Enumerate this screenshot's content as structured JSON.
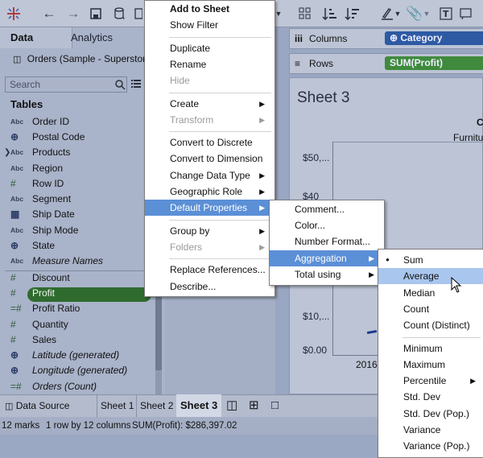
{
  "toolbar": {
    "icons": [
      "tableau-logo-icon",
      "back-icon",
      "forward-icon",
      "save-icon",
      "new-datasource-icon",
      "new-sheet-icon",
      "swap-icon",
      "sort-asc-icon",
      "sort-desc-icon",
      "highlight-icon",
      "pin-icon",
      "text-icon"
    ]
  },
  "left_pane": {
    "tab_data": "Data",
    "tab_analytics": "Analytics",
    "datasource": "Orders (Sample - Superstore)",
    "search_placeholder": "Search",
    "tables_heading": "Tables",
    "fields": [
      {
        "type": "Abc",
        "name": "Order ID"
      },
      {
        "type": "globe",
        "name": "Postal Code"
      },
      {
        "type": "Abc",
        "name": "Products",
        "expandable": true
      },
      {
        "type": "Abc",
        "name": "Region"
      },
      {
        "type": "#",
        "name": "Row ID"
      },
      {
        "type": "Abc",
        "name": "Segment"
      },
      {
        "type": "date",
        "name": "Ship Date"
      },
      {
        "type": "Abc",
        "name": "Ship Mode"
      },
      {
        "type": "globe",
        "name": "State"
      },
      {
        "type": "Abc",
        "name": "Measure Names",
        "italic": true
      },
      {
        "type": "#",
        "name": "Discount"
      },
      {
        "type": "#",
        "name": "Profit",
        "selected": true
      },
      {
        "type": "=#",
        "name": "Profit Ratio"
      },
      {
        "type": "#",
        "name": "Quantity"
      },
      {
        "type": "#",
        "name": "Sales"
      },
      {
        "type": "globe",
        "name": "Latitude (generated)",
        "italic": true
      },
      {
        "type": "globe",
        "name": "Longitude (generated)",
        "italic": true
      },
      {
        "type": "=#",
        "name": "Orders (Count)",
        "italic": true
      }
    ]
  },
  "shelves": {
    "columns_label": "Columns",
    "columns_pill": "Category",
    "rows_label": "Rows",
    "rows_pill": "SUM(Profit)"
  },
  "view": {
    "sheet_title": "Sheet 3",
    "col_header_top": "C",
    "col_header": "Furnitu",
    "y_ticks": [
      "$50,...",
      "$40",
      "$10,...",
      "$0.00"
    ],
    "x_label": "2016"
  },
  "context_menu": {
    "items": [
      {
        "label": "Add to Sheet",
        "bold": true
      },
      {
        "label": "Show Filter"
      },
      {
        "sep": true
      },
      {
        "label": "Duplicate"
      },
      {
        "label": "Rename"
      },
      {
        "label": "Hide",
        "disabled": true
      },
      {
        "sep": true
      },
      {
        "label": "Create",
        "submenu": true
      },
      {
        "label": "Transform",
        "submenu": true,
        "disabled": true
      },
      {
        "sep": true
      },
      {
        "label": "Convert to Discrete"
      },
      {
        "label": "Convert to Dimension"
      },
      {
        "label": "Change Data Type",
        "submenu": true
      },
      {
        "label": "Geographic Role",
        "submenu": true
      },
      {
        "label": "Default Properties",
        "submenu": true,
        "highlighted": true
      },
      {
        "sep": true
      },
      {
        "label": "Group by",
        "submenu": true
      },
      {
        "label": "Folders",
        "submenu": true,
        "disabled": true
      },
      {
        "sep": true
      },
      {
        "label": "Replace References..."
      },
      {
        "label": "Describe..."
      }
    ]
  },
  "default_properties_menu": {
    "items": [
      {
        "label": "Comment..."
      },
      {
        "label": "Color..."
      },
      {
        "label": "Number Format..."
      },
      {
        "label": "Aggregation",
        "submenu": true,
        "highlighted": true
      },
      {
        "label": "Total using",
        "submenu": true
      }
    ]
  },
  "aggregation_menu": {
    "items": [
      {
        "label": "Sum",
        "checked": true
      },
      {
        "label": "Average",
        "hovered": true
      },
      {
        "label": "Median"
      },
      {
        "label": "Count"
      },
      {
        "label": "Count (Distinct)"
      },
      {
        "sep": true
      },
      {
        "label": "Minimum"
      },
      {
        "label": "Maximum"
      },
      {
        "label": "Percentile",
        "submenu": true
      },
      {
        "label": "Std. Dev"
      },
      {
        "label": "Std. Dev (Pop.)"
      },
      {
        "label": "Variance"
      },
      {
        "label": "Variance (Pop.)"
      }
    ]
  },
  "bottom_tabs": {
    "data_source": "Data Source",
    "sheet1": "Sheet 1",
    "sheet2": "Sheet 2",
    "sheet3": "Sheet 3"
  },
  "status": {
    "marks": "12 marks",
    "dims": "1 row by 12 columns",
    "sum": "SUM(Profit): $286,397.02"
  },
  "colors": {
    "menu_highlight": "#5b8fd6",
    "hover_highlight": "#a9c6ee",
    "pill_green": "#2f6b2e",
    "pill_blue": "#2d5aa3"
  }
}
